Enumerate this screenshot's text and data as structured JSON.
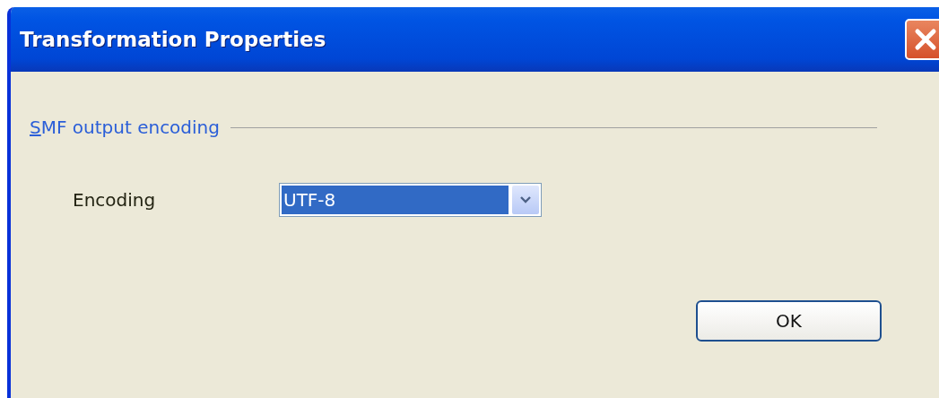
{
  "window": {
    "title": "Transformation Properties"
  },
  "group": {
    "label": "SMF output encoding",
    "mnemonic_underlined": true
  },
  "field": {
    "label": "Encoding",
    "value": "UTF-8",
    "highlighted": true
  },
  "buttons": [
    {
      "label": "OK"
    }
  ]
}
